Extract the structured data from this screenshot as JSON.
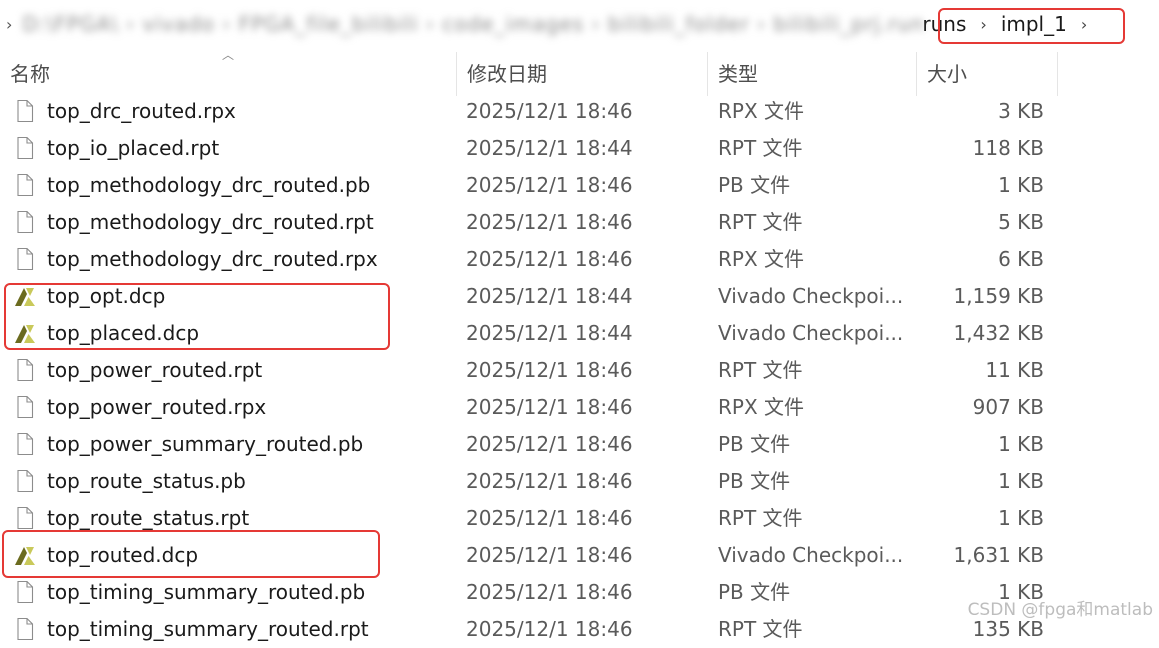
{
  "breadcrumb": {
    "blurred_path": "D:\\FPGA\\ ›  vivado  ›  FPGA_file_bilibili  ›  code_images  ›  bilibili_folder  ›  bilibili_prj.runs",
    "items": [
      "runs",
      "impl_1"
    ]
  },
  "columns": {
    "name": "名称",
    "date": "修改日期",
    "type": "类型",
    "size": "大小"
  },
  "rows": [
    {
      "icon": "file-icon",
      "name": "top_drc_routed.rpx",
      "date": "2025/12/1 18:46",
      "type": "RPX 文件",
      "size": "3 KB"
    },
    {
      "icon": "file-icon",
      "name": "top_io_placed.rpt",
      "date": "2025/12/1 18:44",
      "type": "RPT 文件",
      "size": "118 KB"
    },
    {
      "icon": "file-icon",
      "name": "top_methodology_drc_routed.pb",
      "date": "2025/12/1 18:46",
      "type": "PB 文件",
      "size": "1 KB"
    },
    {
      "icon": "file-icon",
      "name": "top_methodology_drc_routed.rpt",
      "date": "2025/12/1 18:46",
      "type": "RPT 文件",
      "size": "5 KB"
    },
    {
      "icon": "file-icon",
      "name": "top_methodology_drc_routed.rpx",
      "date": "2025/12/1 18:46",
      "type": "RPX 文件",
      "size": "6 KB"
    },
    {
      "icon": "vivado-icon",
      "name": "top_opt.dcp",
      "date": "2025/12/1 18:44",
      "type": "Vivado Checkpoi...",
      "size": "1,159 KB"
    },
    {
      "icon": "vivado-icon",
      "name": "top_placed.dcp",
      "date": "2025/12/1 18:44",
      "type": "Vivado Checkpoi...",
      "size": "1,432 KB"
    },
    {
      "icon": "file-icon",
      "name": "top_power_routed.rpt",
      "date": "2025/12/1 18:46",
      "type": "RPT 文件",
      "size": "11 KB"
    },
    {
      "icon": "file-icon",
      "name": "top_power_routed.rpx",
      "date": "2025/12/1 18:46",
      "type": "RPX 文件",
      "size": "907 KB"
    },
    {
      "icon": "file-icon",
      "name": "top_power_summary_routed.pb",
      "date": "2025/12/1 18:46",
      "type": "PB 文件",
      "size": "1 KB"
    },
    {
      "icon": "file-icon",
      "name": "top_route_status.pb",
      "date": "2025/12/1 18:46",
      "type": "PB 文件",
      "size": "1 KB"
    },
    {
      "icon": "file-icon",
      "name": "top_route_status.rpt",
      "date": "2025/12/1 18:46",
      "type": "RPT 文件",
      "size": "1 KB"
    },
    {
      "icon": "vivado-icon",
      "name": "top_routed.dcp",
      "date": "2025/12/1 18:46",
      "type": "Vivado Checkpoi...",
      "size": "1,631 KB"
    },
    {
      "icon": "file-icon",
      "name": "top_timing_summary_routed.pb",
      "date": "2025/12/1 18:46",
      "type": "PB 文件",
      "size": "1 KB"
    },
    {
      "icon": "file-icon",
      "name": "top_timing_summary_routed.rpt",
      "date": "2025/12/1 18:46",
      "type": "RPT 文件",
      "size": "135 KB"
    }
  ],
  "watermark": "CSDN @fpga和matlab",
  "colors": {
    "highlight": "#e53935",
    "vivado_dark": "#6b6b1f",
    "vivado_light": "#c9c95a"
  }
}
